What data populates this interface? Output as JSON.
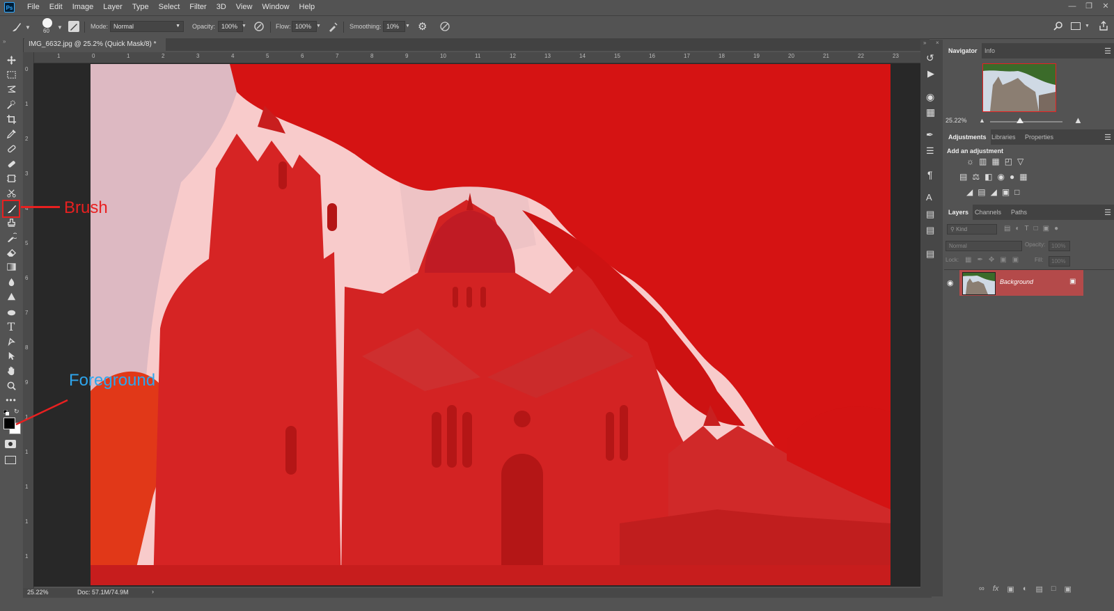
{
  "app": {
    "logo": "Ps"
  },
  "menu": [
    "File",
    "Edit",
    "Image",
    "Layer",
    "Type",
    "Select",
    "Filter",
    "3D",
    "View",
    "Window",
    "Help"
  ],
  "options": {
    "brush_size": "60",
    "mode_label": "Mode:",
    "mode_value": "Normal",
    "opacity_label": "Opacity:",
    "opacity_value": "100%",
    "flow_label": "Flow:",
    "flow_value": "100%",
    "smoothing_label": "Smoothing:",
    "smoothing_value": "10%"
  },
  "document": {
    "tab_title": "IMG_6632.jpg @ 25.2% (Quick Mask/8) *",
    "zoom": "25.22%",
    "doc_info": "Doc: 57.1M/74.9M"
  },
  "rulers": {
    "top": [
      "1",
      "0",
      "1",
      "2",
      "3",
      "4",
      "5",
      "6",
      "7",
      "8",
      "9",
      "10",
      "11",
      "12",
      "13",
      "14",
      "15",
      "16",
      "17",
      "18",
      "19",
      "20",
      "21",
      "22",
      "23"
    ],
    "left": [
      "0",
      "1",
      "2",
      "3",
      "4",
      "5",
      "6",
      "7",
      "8",
      "9",
      "1",
      "1",
      "1",
      "1",
      "1"
    ]
  },
  "annotations": {
    "brush": "Brush",
    "foreground": "Foreground",
    "color": "#e82020",
    "fg_color": "#2ea6ee"
  },
  "navigator": {
    "tabs": [
      "Navigator",
      "Info"
    ],
    "zoom": "25.22%"
  },
  "adjustments": {
    "tabs": [
      "Adjustments",
      "Libraries",
      "Properties"
    ],
    "add_label": "Add an adjustment"
  },
  "layers": {
    "tabs": [
      "Layers",
      "Channels",
      "Paths"
    ],
    "kind": "Kind",
    "blend": "Normal",
    "opacity_label": "Opacity:",
    "opacity_value": "100%",
    "lock_label": "Lock:",
    "fill_label": "Fill:",
    "fill_value": "100%",
    "layer_name": "Background",
    "selected_color": "#b44a4a"
  },
  "quickmask_color": "#d83030"
}
